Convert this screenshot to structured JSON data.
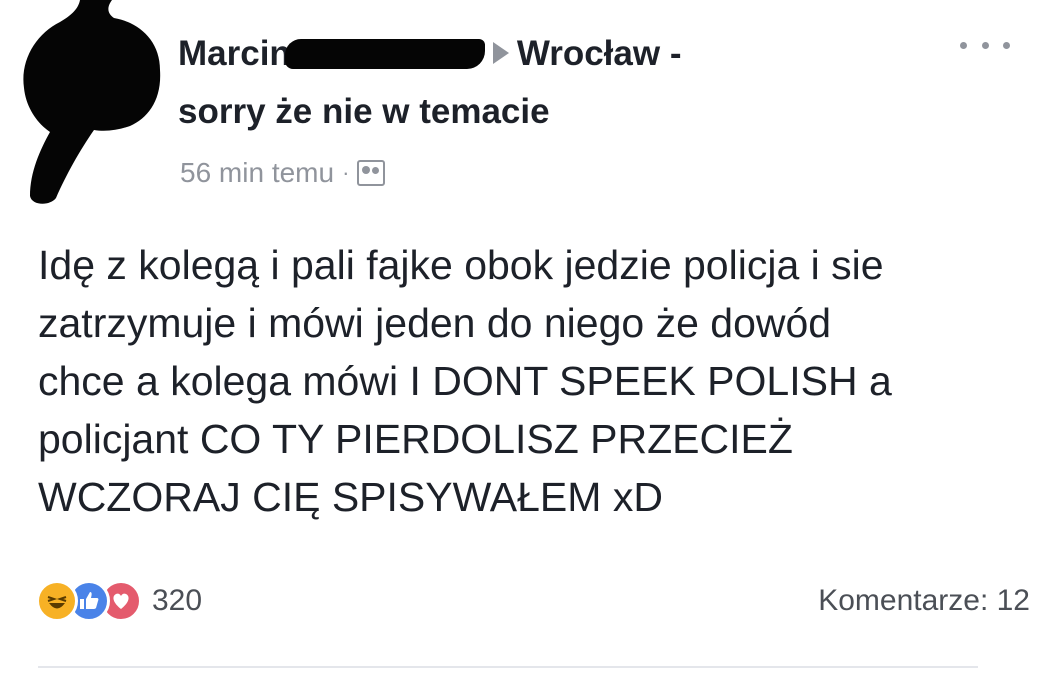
{
  "post": {
    "author_first": "Marcin",
    "group": "Wrocław -",
    "group_line2": "sorry że nie w temacie",
    "timestamp": "56 min temu",
    "separator": "·",
    "text": "Idę z kolegą i pali fajke obok jedzie policja i sie\nzatrzymuje i mówi jeden do niego że dowód\nchce a kolega mówi I DONT SPEEK POLISH a\npolicjant CO TY PIERDOLISZ PRZECIEŻ\nWCZORAJ CIĘ SPISYWAŁEM xD",
    "reaction_count": "320",
    "comments_label": "Komentarze: 12"
  },
  "icons": {
    "avatar": "avatar-redacted",
    "arrow": "triangle-right-icon",
    "privacy": "group-icon",
    "more": "more-icon",
    "reactions": [
      "haha-icon",
      "like-icon",
      "love-icon"
    ]
  },
  "colors": {
    "text": "#1d2129",
    "secondary": "#90949c",
    "haha": "#f7b125",
    "like": "#4a83e8",
    "love": "#e45b6d"
  }
}
